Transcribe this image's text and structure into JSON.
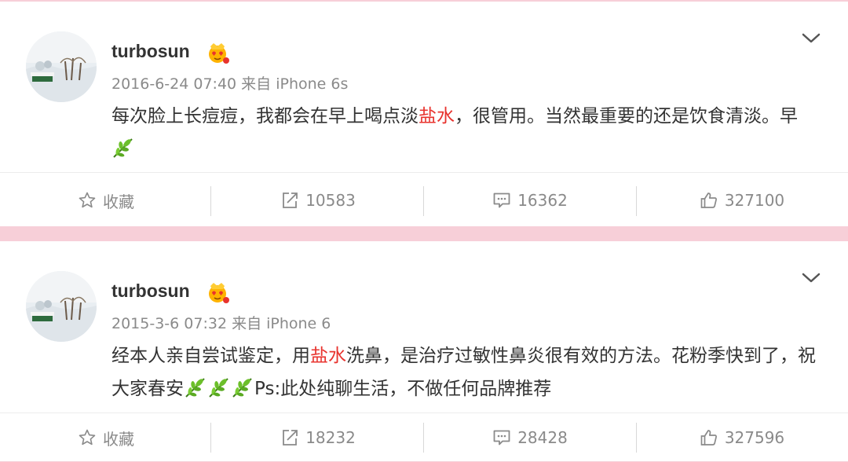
{
  "posts": [
    {
      "username": "turbosun",
      "meta": "2016-6-24 07:40 来自 iPhone 6s",
      "text_before": "每次脸上长痘痘，我都会在早上喝点淡",
      "keyword": "盐水",
      "text_after": "，很管用。当然最重要的还是饮食清淡。早",
      "emoji": "green-leaf",
      "text_tail": "",
      "actions": {
        "favorite_label": "收藏",
        "repost_count": "10583",
        "comment_count": "16362",
        "like_count": "327100"
      }
    },
    {
      "username": "turbosun",
      "meta": "2015-3-6 07:32 来自 iPhone 6",
      "text_before": "经本人亲自尝试鉴定，用",
      "keyword": "盐水",
      "text_after": "洗鼻，是治疗过敏性鼻炎很有效的方法。花粉季快到了，祝大家春安",
      "emoji": "green-leaf",
      "text_tail": "Ps:此处纯聊生活，不做任何品牌推荐",
      "actions": {
        "favorite_label": "收藏",
        "repost_count": "18232",
        "comment_count": "28428",
        "like_count": "327596"
      }
    }
  ],
  "colors": {
    "keyword": "#e8332e",
    "separator": "#f7cfd8",
    "meta_text": "#8a8a8a"
  }
}
